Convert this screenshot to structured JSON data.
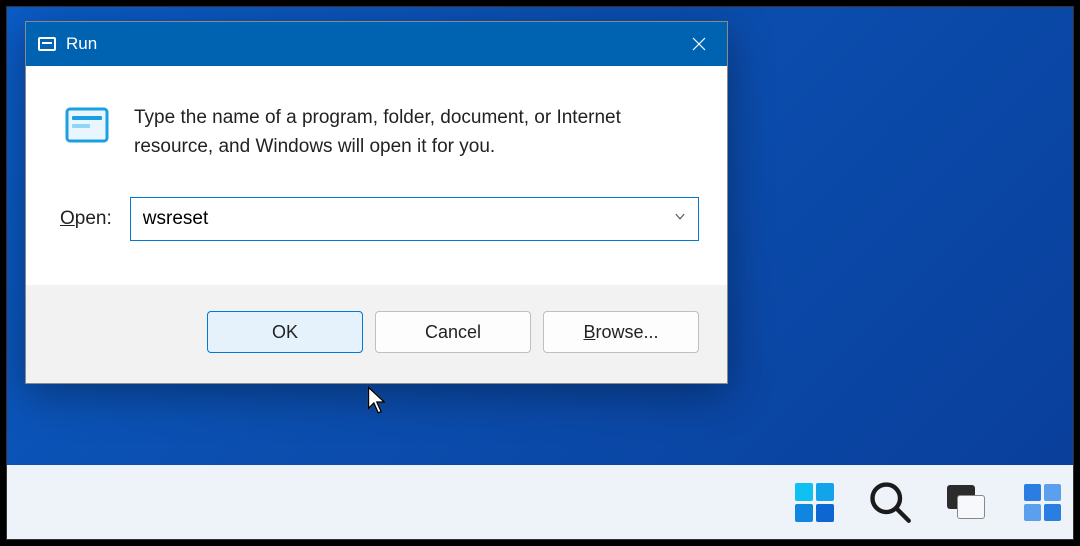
{
  "dialog": {
    "title": "Run",
    "description": "Type the name of a program, folder, document, or Internet resource, and Windows will open it for you.",
    "open_label": "Open:",
    "input_value": "wsreset",
    "buttons": {
      "ok": "OK",
      "cancel": "Cancel",
      "browse": "Browse..."
    }
  },
  "icons": {
    "run": "run-icon",
    "close": "close-icon",
    "chevron": "chevron-down-icon",
    "cursor": "cursor-icon"
  },
  "taskbar": {
    "start": "start-icon",
    "search": "search-icon",
    "taskview": "taskview-icon",
    "widgets": "widgets-icon"
  },
  "colors": {
    "accent": "#0063b1",
    "input_border": "#0078d4",
    "button_primary_bg": "#e5f1fb",
    "taskbar_bg": "#eef3fa"
  }
}
